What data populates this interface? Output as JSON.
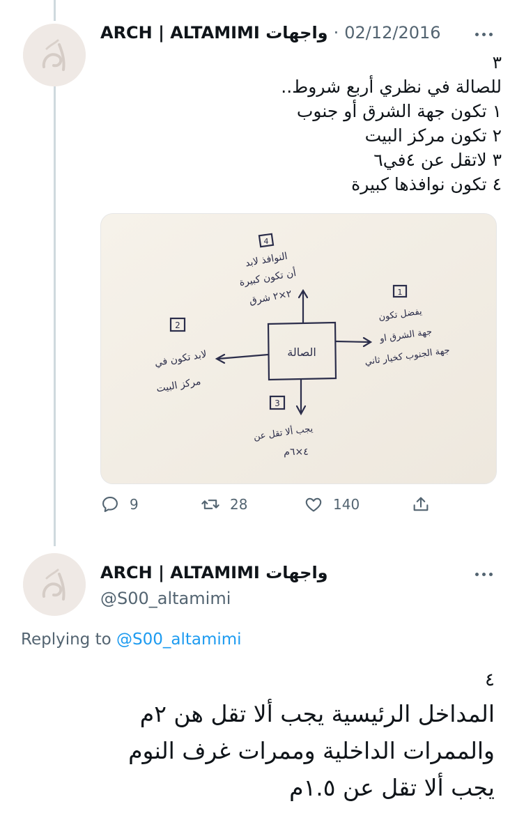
{
  "tweet1": {
    "author_name": "ARCH | ALTAMIMI واجهات",
    "date_sep": "·",
    "date": "02/12/2016",
    "lines": [
      "٣",
      "للصالة في نظري أربع شروط..",
      "١ تكون جهة الشرق أو جنوب",
      "٢ تكون مركز البيت",
      "٣ لاتقل عن ٤في٦",
      "٤ تكون نوافذها كبيرة"
    ],
    "replies": "9",
    "retweets": "28",
    "likes": "140"
  },
  "tweet2": {
    "author_name": "ARCH | ALTAMIMI واجهات",
    "handle": "@S00_altamimi",
    "replying_label": "Replying to",
    "replying_to": "@S00_altamimi",
    "lines": [
      "٤",
      "المداخل الرئيسية يجب ألا تقل هن ٢م",
      "والممرات الداخلية وممرات غرف النوم",
      "يجب ألا تقل عن ١.٥م"
    ]
  },
  "sketch": {
    "center": "الصالة",
    "n1": "1",
    "n2": "2",
    "n3": "3",
    "n4": "4",
    "note1": [
      "يفضل تكون",
      "جهة الشرق او",
      "جهة الجنوب كخيار ثاني"
    ],
    "note2": [
      "لابد تكون في",
      "مركز البيت"
    ],
    "note3": [
      "يجب ألا تقل عن",
      "٤×٦م"
    ],
    "note4": [
      "النوافذ لابد",
      "أن تكون كبيرة",
      "٢×٢ شرق"
    ]
  },
  "icons": {
    "reply": "reply-icon",
    "retweet": "retweet-icon",
    "like": "heart-icon",
    "share": "share-icon",
    "more": "more-icon"
  },
  "colors": {
    "secondary": "#536471",
    "link": "#1d9bf0",
    "thread": "#cfd9de"
  }
}
